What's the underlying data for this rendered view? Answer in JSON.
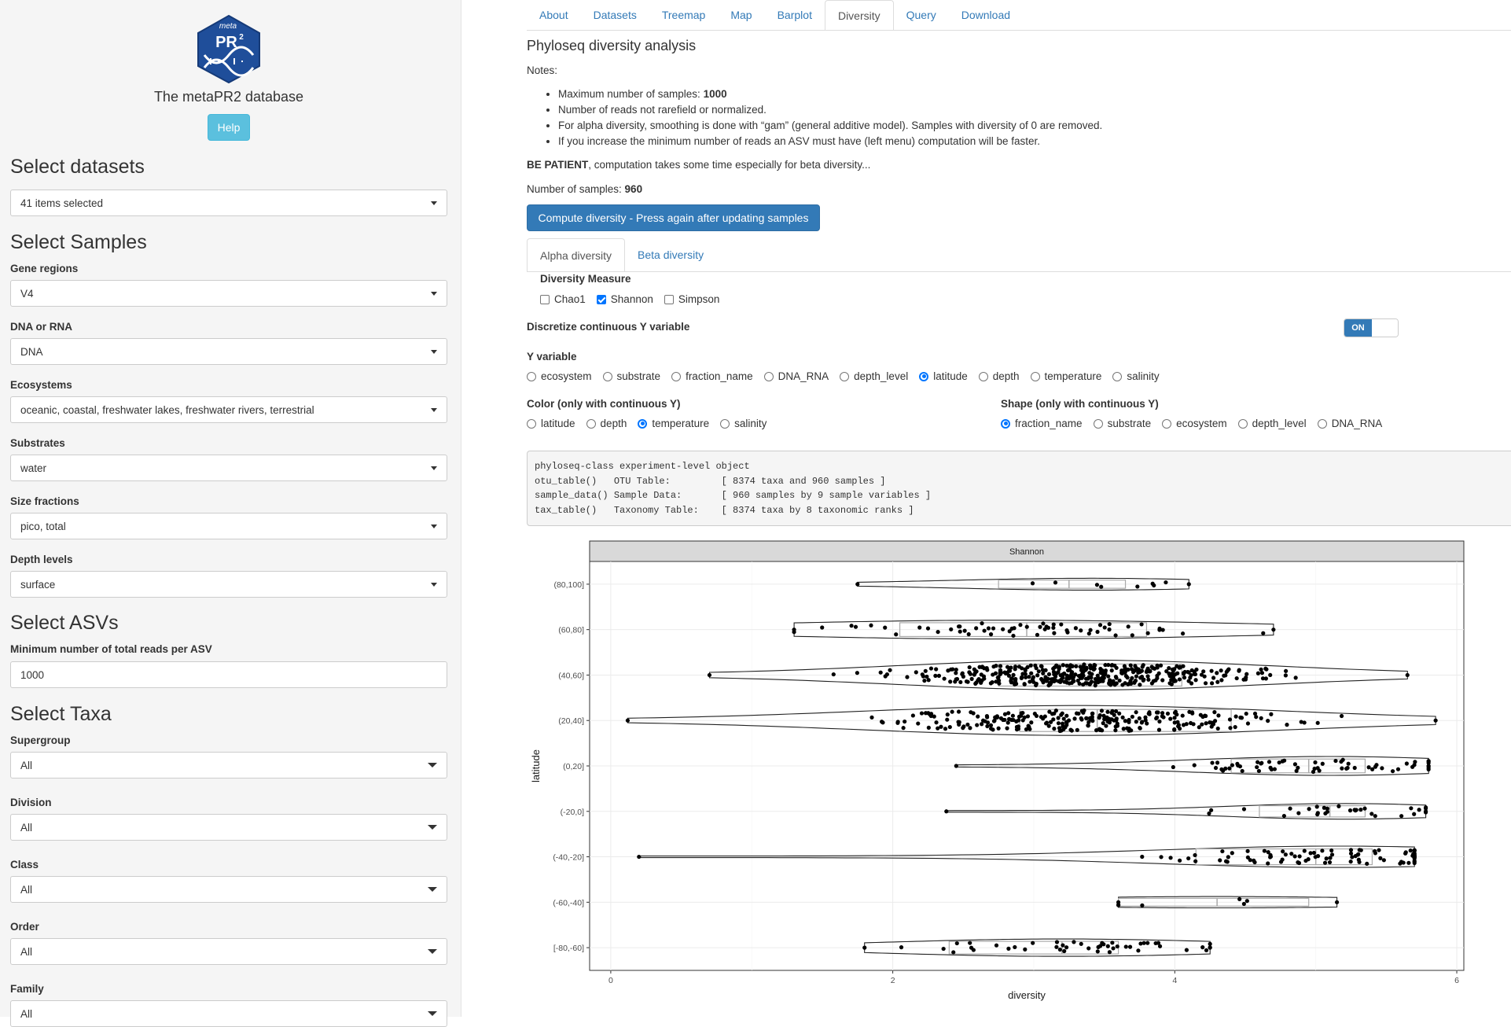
{
  "sidebar": {
    "logo": {
      "top_text": "meta",
      "main_text": "PR",
      "superscript": "2",
      "icon": "dna-hexagon-logo",
      "color": "#1f4e9a"
    },
    "app_title": "The metaPR2 database",
    "help_label": "Help",
    "datasets_title": "Select datasets",
    "datasets_value": "41 items selected",
    "samples_title": "Select Samples",
    "gene_regions": {
      "label": "Gene regions",
      "value": "V4"
    },
    "dna_rna": {
      "label": "DNA or RNA",
      "value": "DNA"
    },
    "ecosystems": {
      "label": "Ecosystems",
      "value": "oceanic, coastal, freshwater lakes, freshwater rivers, terrestrial"
    },
    "substrates": {
      "label": "Substrates",
      "value": "water"
    },
    "size_fractions": {
      "label": "Size fractions",
      "value": "pico, total"
    },
    "depth_levels": {
      "label": "Depth levels",
      "value": "surface"
    },
    "asvs_title": "Select ASVs",
    "min_reads": {
      "label": "Minimum number of total reads per ASV",
      "value": "1000"
    },
    "taxa_title": "Select Taxa",
    "supergroup": {
      "label": "Supergroup",
      "value": "All"
    },
    "division": {
      "label": "Division",
      "value": "All"
    },
    "class": {
      "label": "Class",
      "value": "All"
    },
    "order": {
      "label": "Order",
      "value": "All"
    },
    "family": {
      "label": "Family",
      "value": "All"
    }
  },
  "tabs": [
    "About",
    "Datasets",
    "Treemap",
    "Map",
    "Barplot",
    "Diversity",
    "Query",
    "Download"
  ],
  "active_tab": "Diversity",
  "main": {
    "title": "Phyloseq diversity analysis",
    "notes_label": "Notes:",
    "note1_prefix": "Maximum number of samples: ",
    "note1_value": "1000",
    "note2": "Number of reads not rarefield or normalized.",
    "note3": "For alpha diversity, smoothing is done with “gam” (general additive model). Samples with diversity of 0 are removed.",
    "note4": "If you increase the minimum number of reads an ASV must have (left menu) computation will be faster.",
    "patient_bold": "BE PATIENT",
    "patient_rest": ", computation takes some time especially for beta diversity...",
    "nsamples_prefix": "Number of samples: ",
    "nsamples_value": "960",
    "compute_label": "Compute diversity - Press again after updating samples",
    "subtab_alpha": "Alpha diversity",
    "subtab_beta": "Beta diversity",
    "diversity_measure_label": "Diversity Measure",
    "measures": [
      {
        "label": "Chao1",
        "checked": false
      },
      {
        "label": "Shannon",
        "checked": true
      },
      {
        "label": "Simpson",
        "checked": false
      }
    ],
    "discretize_label": "Discretize continuous Y variable",
    "toggle_on": "ON",
    "yvar_label": "Y variable",
    "yvars": [
      {
        "label": "ecosystem",
        "checked": false
      },
      {
        "label": "substrate",
        "checked": false
      },
      {
        "label": "fraction_name",
        "checked": false
      },
      {
        "label": "DNA_RNA",
        "checked": false
      },
      {
        "label": "depth_level",
        "checked": false
      },
      {
        "label": "latitude",
        "checked": true
      },
      {
        "label": "depth",
        "checked": false
      },
      {
        "label": "temperature",
        "checked": false
      },
      {
        "label": "salinity",
        "checked": false
      }
    ],
    "color_label": "Color (only with continuous Y)",
    "colors": [
      {
        "label": "latitude",
        "checked": false
      },
      {
        "label": "depth",
        "checked": false
      },
      {
        "label": "temperature",
        "checked": true
      },
      {
        "label": "salinity",
        "checked": false
      }
    ],
    "shape_label": "Shape (only with continuous Y)",
    "shapes": [
      {
        "label": "fraction_name",
        "checked": true
      },
      {
        "label": "substrate",
        "checked": false
      },
      {
        "label": "ecosystem",
        "checked": false
      },
      {
        "label": "depth_level",
        "checked": false
      },
      {
        "label": "DNA_RNA",
        "checked": false
      }
    ],
    "phyloseq_lines": [
      "phyloseq-class experiment-level object",
      "otu_table()   OTU Table:         [ 8374 taxa and 960 samples ]",
      "sample_data() Sample Data:       [ 960 samples by 9 sample variables ]",
      "tax_table()   Taxonomy Table:    [ 8374 taxa by 8 taxonomic ranks ]"
    ]
  },
  "chart_data": {
    "type": "violin",
    "title": "",
    "facet_label": "Shannon",
    "xlabel": "diversity",
    "ylabel": "latitude",
    "xlim": [
      -0.15,
      6.05
    ],
    "xticks": [
      0,
      2,
      4,
      6
    ],
    "categories": [
      "(80,100]",
      "(60,80]",
      "(40,60]",
      "(20,40]",
      "(0,20]",
      "(-20,0]",
      "(-40,-20]",
      "(-60,-40]",
      "[-80,-60]"
    ],
    "grid": true,
    "groups": [
      {
        "cat": "(80,100]",
        "range": [
          1.75,
          4.1
        ],
        "q1": 2.75,
        "median": 3.25,
        "q3": 3.65,
        "n": 8,
        "peak": 3.4
      },
      {
        "cat": "(60,80]",
        "range": [
          1.3,
          4.7
        ],
        "q1": 2.05,
        "median": 2.95,
        "q3": 3.8,
        "n": 60,
        "peak": 2.8
      },
      {
        "cat": "(40,60]",
        "range": [
          0.7,
          5.65
        ],
        "q1": 2.75,
        "median": 3.4,
        "q3": 4.05,
        "n": 420,
        "peak": 3.35
      },
      {
        "cat": "(20,40]",
        "range": [
          0.12,
          5.85
        ],
        "q1": 2.9,
        "median": 3.45,
        "q3": 4.4,
        "n": 260,
        "peak": 3.3
      },
      {
        "cat": "(0,20]",
        "range": [
          2.45,
          5.8
        ],
        "q1": 4.4,
        "median": 4.95,
        "q3": 5.35,
        "n": 60,
        "peak": 5.1
      },
      {
        "cat": "(-20,0]",
        "range": [
          2.38,
          5.78
        ],
        "q1": 4.6,
        "median": 5.1,
        "q3": 5.35,
        "n": 30,
        "peak": 5.2
      },
      {
        "cat": "(-40,-20]",
        "range": [
          0.2,
          5.7
        ],
        "q1": 4.15,
        "median": 5.0,
        "q3": 5.4,
        "n": 90,
        "peak": 5.15
      },
      {
        "cat": "(-60,-40]",
        "range": [
          3.6,
          5.15
        ],
        "q1": 3.6,
        "median": 4.3,
        "q3": 4.95,
        "n": 6,
        "peak": 4.3
      },
      {
        "cat": "[-80,-60]",
        "range": [
          1.8,
          4.25
        ],
        "q1": 2.4,
        "median": 3.2,
        "q3": 3.6,
        "n": 45,
        "peak": 3.2
      }
    ]
  }
}
